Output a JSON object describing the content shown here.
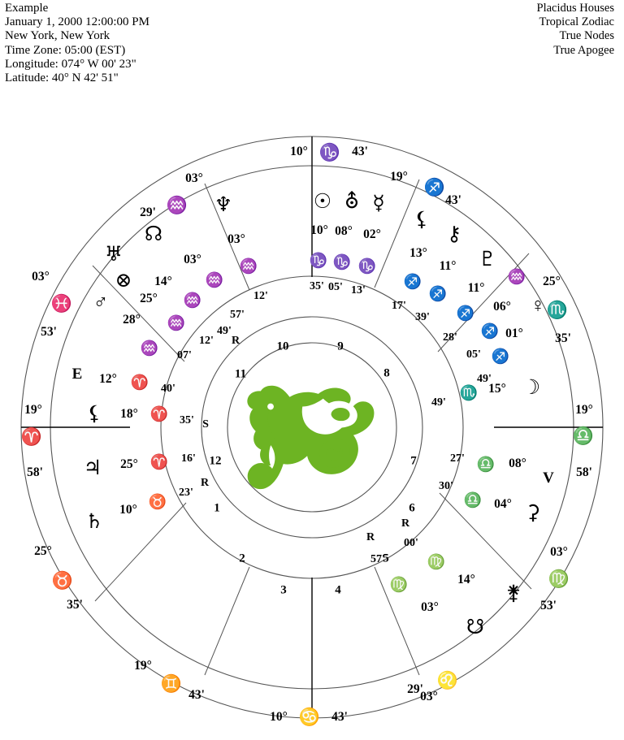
{
  "header": {
    "left": [
      "Example",
      "January 1, 2000  12:00:00 PM",
      "New York, New York",
      "Time Zone: 05:00 (EST)",
      "Longitude: 074° W 00' 23\"",
      "Latitude: 40° N 42' 51\""
    ],
    "right": [
      "Placidus Houses",
      "Tropical Zodiac",
      "True Nodes",
      "True Apogee"
    ]
  },
  "colors": {
    "emblem_green": "#6db423",
    "ring_stroke": "#555555",
    "axis_stroke": "#000000",
    "text": "#000000",
    "background": "#ffffff"
  },
  "wheel": {
    "center_emblem": "capricorn-sea-goat-emblem",
    "house_numbers": [
      "1",
      "2",
      "3",
      "4",
      "5",
      "6",
      "7",
      "8",
      "9",
      "10",
      "11",
      "12"
    ],
    "angle_letters": [
      {
        "label": "E",
        "name": "ascendant-marker"
      },
      {
        "label": "V",
        "name": "descendant-marker"
      }
    ],
    "cusps": [
      {
        "name": "mc-cusp",
        "deg": "10°",
        "sign": "capricorn",
        "glyph": "♑",
        "min": "43'"
      },
      {
        "name": "house-11-cusp",
        "deg": "03°",
        "sign": "aquarius",
        "glyph": "♒",
        "min": "29'"
      },
      {
        "name": "house-12-cusp",
        "deg": "03°",
        "sign": "pisces",
        "glyph": "♓",
        "min": "53'"
      },
      {
        "name": "ascendant-cusp",
        "deg": "19°",
        "sign": "aries",
        "glyph": "♈",
        "min": "58'"
      },
      {
        "name": "house-2-cusp",
        "deg": "25°",
        "sign": "taurus",
        "glyph": "♉",
        "min": "35'"
      },
      {
        "name": "house-3-cusp",
        "deg": "19°",
        "sign": "gemini",
        "glyph": "♊",
        "min": "43'"
      },
      {
        "name": "ic-cusp",
        "deg": "10°",
        "sign": "cancer",
        "glyph": "♋",
        "min": "43'"
      },
      {
        "name": "house-5-cusp",
        "deg": "03°",
        "sign": "leo",
        "glyph": "♌",
        "min": "29'"
      },
      {
        "name": "house-6-cusp",
        "deg": "03°",
        "sign": "virgo",
        "glyph": "♍",
        "min": "53'"
      },
      {
        "name": "descendant-cusp",
        "deg": "19°",
        "sign": "libra",
        "glyph": "♎",
        "min": "58'"
      },
      {
        "name": "house-8-cusp",
        "deg": "25°",
        "sign": "scorpio",
        "glyph": "♏",
        "min": "35'"
      },
      {
        "name": "house-9-cusp",
        "deg": "19°",
        "sign": "sagittarius",
        "glyph": "♐",
        "min": "43'"
      }
    ],
    "planets": [
      {
        "name": "sun",
        "glyph": "☉",
        "deg": "10°",
        "sign": "♑",
        "min": "35'",
        "retro": ""
      },
      {
        "name": "uranus",
        "glyph": "⛢",
        "deg": "08°",
        "sign": "♑",
        "min": "05'",
        "retro": ""
      },
      {
        "name": "mercury",
        "glyph": "☿",
        "deg": "02°",
        "sign": "♑",
        "min": "13'",
        "retro": ""
      },
      {
        "name": "lilith-apogee",
        "glyph": "⚸",
        "deg": "13°",
        "sign": "♐",
        "min": "17'",
        "retro": ""
      },
      {
        "name": "chiron",
        "glyph": "⚷",
        "deg": "11°",
        "sign": "♐",
        "min": "39'",
        "retro": ""
      },
      {
        "name": "pluto",
        "glyph": "♇",
        "deg": "11°",
        "sign": "♐",
        "min": "28'",
        "retro": ""
      },
      {
        "name": "neptune-9th",
        "glyph": "♒",
        "deg": "06°",
        "sign": "♐",
        "min": "05'",
        "retro": ""
      },
      {
        "name": "venus",
        "glyph": "♀",
        "deg": "01°",
        "sign": "♐",
        "min": "49'",
        "retro": ""
      },
      {
        "name": "moon",
        "glyph": "☽",
        "deg": "15°",
        "sign": "♏",
        "min": "49'",
        "retro": ""
      },
      {
        "name": "vertex",
        "glyph": "♎",
        "deg": "08°",
        "sign": "♎",
        "min": "27'",
        "retro": ""
      },
      {
        "name": "ceres",
        "glyph": "⚳",
        "deg": "04°",
        "sign": "♎",
        "min": "30'",
        "retro": ""
      },
      {
        "name": "juno",
        "glyph": "⚵",
        "deg": "14°",
        "sign": "♍",
        "min": "00'",
        "retro": "R"
      },
      {
        "name": "south-node",
        "glyph": "☋",
        "deg": "03°",
        "sign": "♍",
        "min": "57'",
        "retro": "R"
      },
      {
        "name": "saturn",
        "glyph": "♄",
        "deg": "10°",
        "sign": "♉",
        "min": "23'",
        "retro": "R"
      },
      {
        "name": "jupiter",
        "glyph": "♃",
        "deg": "25°",
        "sign": "♈",
        "min": "16'",
        "retro": ""
      },
      {
        "name": "apogee",
        "glyph": "⚸",
        "deg": "18°",
        "sign": "♈",
        "min": "35'",
        "retro": "S"
      },
      {
        "name": "east-point",
        "glyph": "♈",
        "deg": "12°",
        "sign": "♈",
        "min": "40'",
        "retro": ""
      },
      {
        "name": "part-of-fortune",
        "glyph": "⊗",
        "deg": "28°",
        "sign": "♒",
        "min": "07'",
        "retro": ""
      },
      {
        "name": "mars",
        "glyph": "♂",
        "deg": "25°",
        "sign": "♒",
        "min": "12'",
        "retro": ""
      },
      {
        "name": "uranus-11th",
        "glyph": "♅",
        "deg": "14°",
        "sign": "♒",
        "min": "49'",
        "retro": ""
      },
      {
        "name": "north-node",
        "glyph": "☊",
        "deg": "03°",
        "sign": "♒",
        "min": "57'",
        "retro": "R"
      },
      {
        "name": "neptune",
        "glyph": "♆",
        "deg": "03°",
        "sign": "♒",
        "min": "12'",
        "retro": "R"
      }
    ]
  }
}
